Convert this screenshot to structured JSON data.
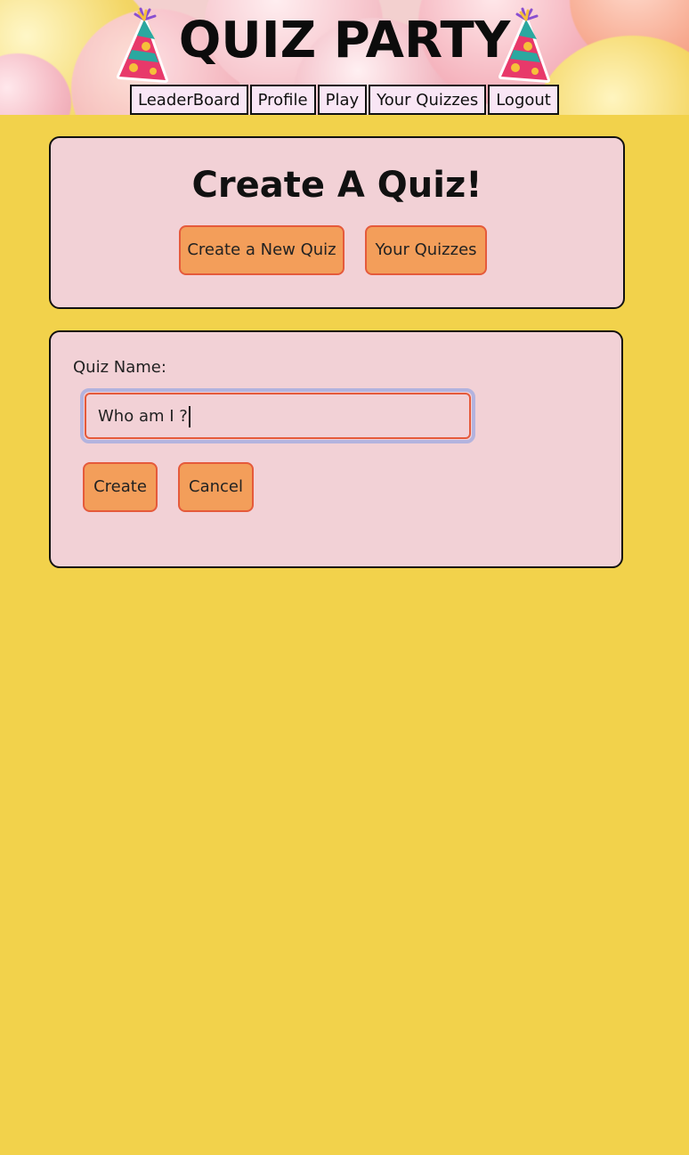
{
  "header": {
    "title": "QUIZ PARTY"
  },
  "nav": {
    "items": [
      {
        "label": "LeaderBoard"
      },
      {
        "label": "Profile"
      },
      {
        "label": "Play"
      },
      {
        "label": "Your Quizzes"
      },
      {
        "label": "Logout"
      }
    ]
  },
  "create_card": {
    "heading": "Create A Quiz!",
    "new_quiz_label": "Create a New Quiz",
    "your_quizzes_label": "Your Quizzes"
  },
  "form": {
    "quiz_name_label": "Quiz Name:",
    "quiz_name_value": "Who am I ?",
    "create_label": "Create",
    "cancel_label": "Cancel"
  },
  "colors": {
    "page_background": "#f2d24b",
    "card_background": "#f2d1d6",
    "button_fill": "#f39e5a",
    "button_border": "#e55a3b",
    "nav_background": "#f9e6f5",
    "focus_ring": "#b3b3de"
  },
  "icons": {
    "left_decoration": "party-hat-icon",
    "right_decoration": "party-hat-icon"
  }
}
